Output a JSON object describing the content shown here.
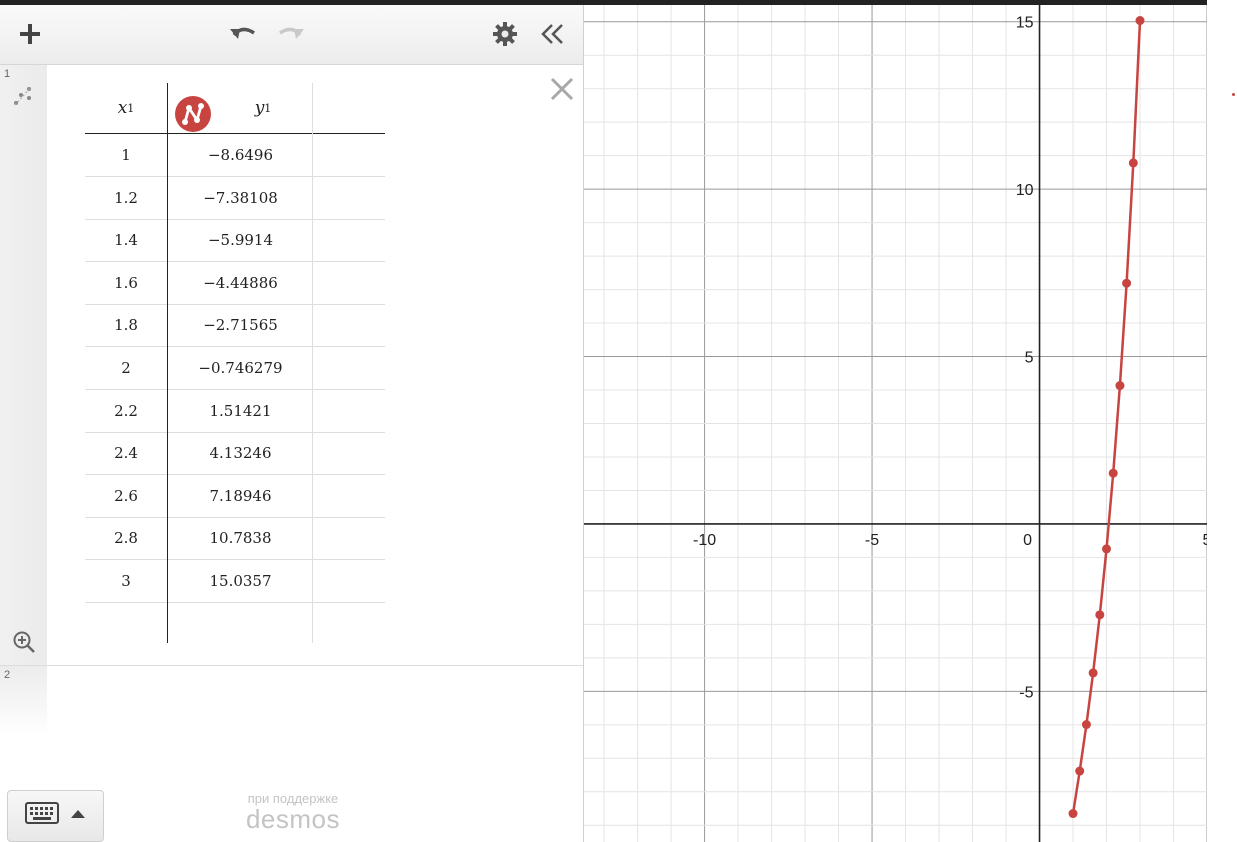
{
  "toolbar": {
    "add_icon": "plus-icon",
    "undo_icon": "undo-icon",
    "redo_icon": "redo-icon",
    "settings_icon": "gear-icon",
    "collapse_icon": "double-chevron-left-icon"
  },
  "expressions": [
    {
      "index": "1",
      "type": "table",
      "header": {
        "x_var": "x",
        "x_sub": "1",
        "y_var": "y",
        "y_sub": "1"
      },
      "rows": [
        {
          "x": "1",
          "y": "−8.6496"
        },
        {
          "x": "1.2",
          "y": "−7.38108"
        },
        {
          "x": "1.4",
          "y": "−5.9914"
        },
        {
          "x": "1.6",
          "y": "−4.44886"
        },
        {
          "x": "1.8",
          "y": "−2.71565"
        },
        {
          "x": "2",
          "y": "−0.746279"
        },
        {
          "x": "2.2",
          "y": "1.51421"
        },
        {
          "x": "2.4",
          "y": "4.13246"
        },
        {
          "x": "2.6",
          "y": "7.18946"
        },
        {
          "x": "2.8",
          "y": "10.7838"
        },
        {
          "x": "3",
          "y": "15.0357"
        }
      ],
      "color": "#c74440"
    },
    {
      "index": "2",
      "type": "empty"
    }
  ],
  "footer": {
    "powered_by": "при поддержке",
    "brand": "desmos"
  },
  "chart_data": {
    "type": "line",
    "series": [
      {
        "x": [
          1,
          1.2,
          1.4,
          1.6,
          1.8,
          2,
          2.2,
          2.4,
          2.6,
          2.8,
          3
        ],
        "y": [
          -8.6496,
          -7.38108,
          -5.9914,
          -4.44886,
          -2.71565,
          -0.746279,
          1.51421,
          4.13246,
          7.18946,
          10.7838,
          15.0357
        ],
        "color": "#c74440"
      }
    ],
    "xlim": [
      -13.6,
      5
    ],
    "ylim": [
      -9.5,
      15.5
    ],
    "x_ticks": [
      "-10",
      "-5",
      "0",
      "5"
    ],
    "y_ticks": [
      "15",
      "10",
      "5",
      "-5"
    ],
    "grid": true
  }
}
